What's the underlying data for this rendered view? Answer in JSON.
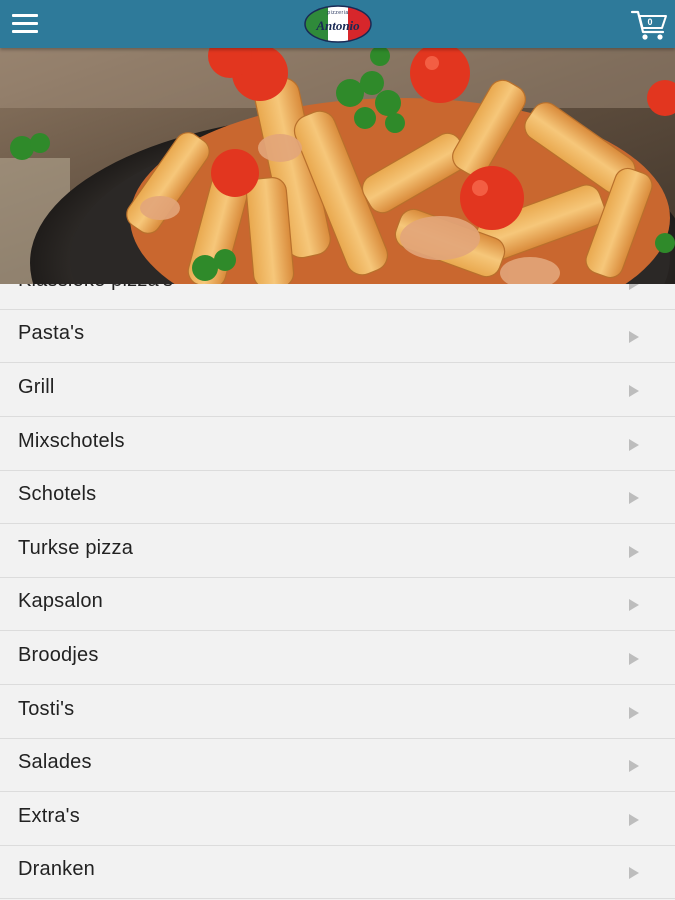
{
  "header": {
    "menu_icon": "hamburger-menu-icon",
    "logo_text": "Antonio",
    "logo_subtext": "pizzeria",
    "cart_icon": "shopping-cart-icon",
    "cart_count": "0"
  },
  "hero": {
    "image": "pasta-dish-photo"
  },
  "categories": {
    "items": [
      {
        "label": "Klassieke pizza's"
      },
      {
        "label": "Pasta's"
      },
      {
        "label": "Grill"
      },
      {
        "label": "Mixschotels"
      },
      {
        "label": "Schotels"
      },
      {
        "label": "Turkse pizza"
      },
      {
        "label": "Kapsalon"
      },
      {
        "label": "Broodjes"
      },
      {
        "label": "Tosti's"
      },
      {
        "label": "Salades"
      },
      {
        "label": "Extra's"
      },
      {
        "label": "Dranken"
      }
    ],
    "arrow_icon": "chevron-right-icon"
  }
}
